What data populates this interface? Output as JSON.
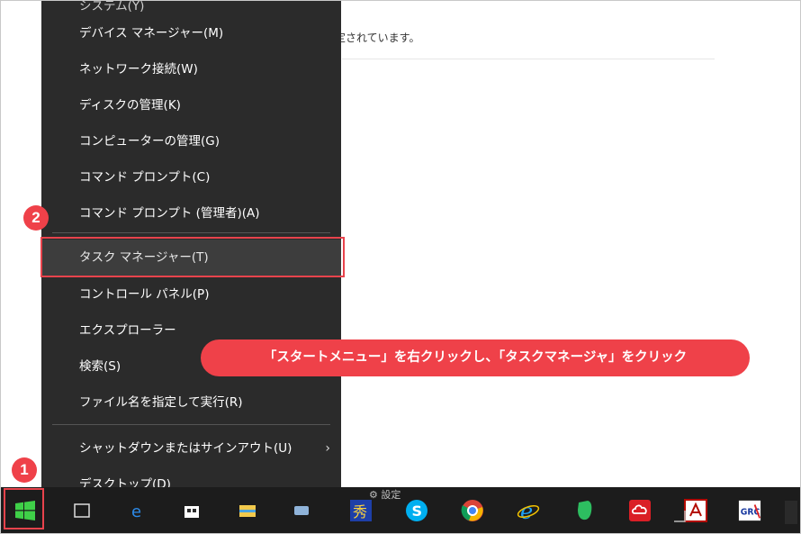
{
  "background": {
    "text": "定されています。"
  },
  "context_menu": {
    "items": [
      {
        "label": "システム(Y)",
        "partial": true
      },
      {
        "label": "デバイス マネージャー(M)"
      },
      {
        "label": "ネットワーク接続(W)"
      },
      {
        "label": "ディスクの管理(K)"
      },
      {
        "label": "コンピューターの管理(G)"
      },
      {
        "label": "コマンド プロンプト(C)"
      },
      {
        "label": "コマンド プロンプト (管理者)(A)"
      },
      {
        "label": "タスク マネージャー(T)",
        "highlighted": true
      },
      {
        "label": "コントロール パネル(P)"
      },
      {
        "label": "エクスプローラー"
      },
      {
        "label": "検索(S)"
      },
      {
        "label": "ファイル名を指定して実行(R)"
      },
      {
        "label": "シャットダウンまたはサインアウト(U)",
        "has_submenu": true
      },
      {
        "label": "デスクトップ(D)"
      }
    ],
    "submenu_chevron": "›"
  },
  "annotations": {
    "step1": "1",
    "step2": "2",
    "callout": "「スタートメニュー」を右クリックし、「タスクマネージャ」をクリック",
    "accent_color": "#ef4149"
  },
  "taskbar": {
    "search_stub": "⚙ 設定",
    "icons": [
      {
        "name": "start-icon"
      },
      {
        "name": "task-view-icon"
      },
      {
        "name": "edge-icon"
      },
      {
        "name": "store-icon"
      },
      {
        "name": "file-explorer-icon"
      },
      {
        "name": "app-icon"
      },
      {
        "name": "ime-icon"
      },
      {
        "name": "skype-icon",
        "glyph": "S"
      },
      {
        "name": "chrome-icon"
      },
      {
        "name": "internet-explorer-icon",
        "glyph": "e"
      },
      {
        "name": "evernote-icon"
      },
      {
        "name": "creative-cloud-icon"
      },
      {
        "name": "acrobat-icon"
      },
      {
        "name": "network-icon"
      },
      {
        "name": "greenshot-icon",
        "glyph": "GRC"
      }
    ]
  }
}
